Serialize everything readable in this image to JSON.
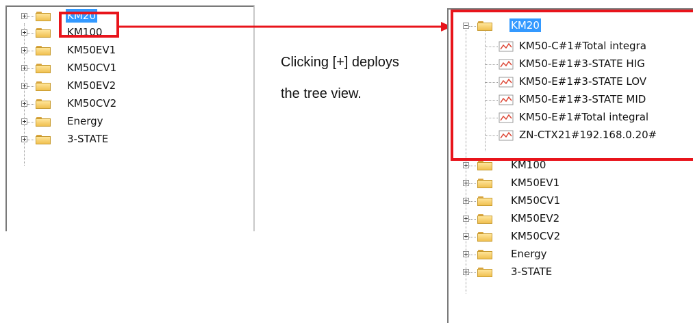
{
  "left_tree": {
    "items": [
      {
        "label": "KM20",
        "selected": true,
        "expanded": false
      },
      {
        "label": "KM100"
      },
      {
        "label": "KM50EV1"
      },
      {
        "label": "KM50CV1"
      },
      {
        "label": "KM50EV2"
      },
      {
        "label": "KM50CV2"
      },
      {
        "label": "Energy"
      },
      {
        "label": "3-STATE"
      }
    ]
  },
  "caption": {
    "line1": "Clicking [+] deploys",
    "line2": "the tree view."
  },
  "right_tree": {
    "root": {
      "label": "KM20",
      "selected": true,
      "expanded": true
    },
    "children": [
      {
        "label": "KM50-C#1#Total integra"
      },
      {
        "label": "KM50-E#1#3-STATE HIG"
      },
      {
        "label": "KM50-E#1#3-STATE LOV"
      },
      {
        "label": "KM50-E#1#3-STATE MID"
      },
      {
        "label": "KM50-E#1#Total integral"
      },
      {
        "label": "ZN-CTX21#192.168.0.20#"
      }
    ],
    "siblings": [
      {
        "label": "KM100"
      },
      {
        "label": "KM50EV1"
      },
      {
        "label": "KM50CV1"
      },
      {
        "label": "KM50EV2"
      },
      {
        "label": "KM50CV2"
      },
      {
        "label": "Energy"
      },
      {
        "label": "3-STATE"
      }
    ]
  },
  "colors": {
    "highlight": "#e8141b",
    "selection": "#3399ff"
  },
  "icons": {
    "expander": "plus-minus-box",
    "folder": "folder-icon",
    "chart": "chart-line-icon"
  }
}
